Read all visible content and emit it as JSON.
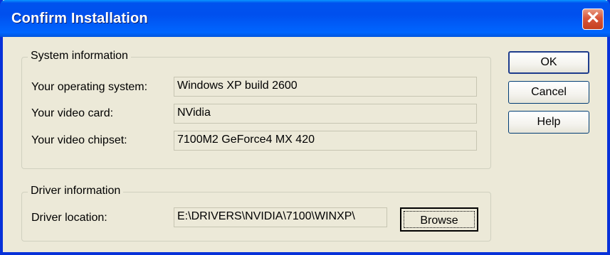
{
  "window": {
    "title": "Confirm Installation",
    "close_glyph": "✕"
  },
  "system_group": {
    "title": "System information",
    "fields": [
      {
        "label": "Your operating system:",
        "value": "Windows XP  build 2600"
      },
      {
        "label": "Your video card:",
        "value": "NVidia"
      },
      {
        "label": "Your video chipset:",
        "value": "7100M2 GeForce4 MX 420"
      }
    ]
  },
  "driver_group": {
    "title": "Driver information",
    "location_label": "Driver location:",
    "location_value": "E:\\DRIVERS\\NVIDIA\\7100\\WINXP\\",
    "browse_label": "Browse"
  },
  "buttons": {
    "ok": "OK",
    "cancel": "Cancel",
    "help": "Help"
  },
  "colors": {
    "titlebar": "#0053ee",
    "face": "#ece9d8",
    "close": "#d8553a"
  }
}
